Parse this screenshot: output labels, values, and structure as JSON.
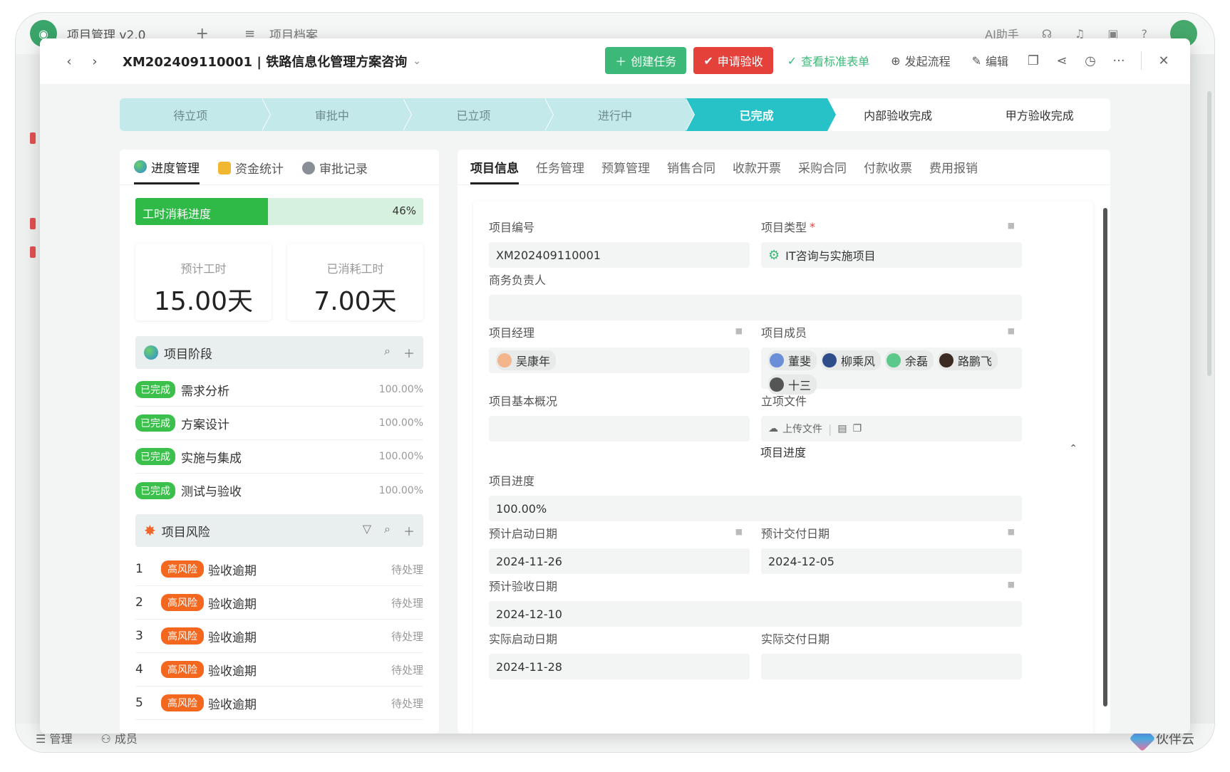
{
  "background": {
    "app_title": "项目管理 v2.0",
    "doc_title": "项目档案",
    "ai_label": "AI助手",
    "bottom_manage": "管理",
    "bottom_members": "成员",
    "brand_name": "伙伴云"
  },
  "header": {
    "project_code": "XM202409110001",
    "project_name": "铁路信息化管理方案咨询",
    "title": "XM202409110001 | 铁路信息化管理方案咨询",
    "create_task": "创建任务",
    "apply_acceptance": "申请验收",
    "view_standard_form": "查看标准表单",
    "start_flow": "发起流程",
    "edit": "编辑"
  },
  "steps": [
    {
      "label": "待立项",
      "state": "done"
    },
    {
      "label": "审批中",
      "state": "done"
    },
    {
      "label": "已立项",
      "state": "done"
    },
    {
      "label": "进行中",
      "state": "done"
    },
    {
      "label": "已完成",
      "state": "current"
    },
    {
      "label": "内部验收完成",
      "state": "todo"
    },
    {
      "label": "甲方验收完成",
      "state": "todo"
    }
  ],
  "left": {
    "tabs": [
      "进度管理",
      "资金统计",
      "审批记录"
    ],
    "hours_label": "工时消耗进度",
    "hours_pct": "46%",
    "hours_value": 0.46,
    "planned_label": "预计工时",
    "planned_value": "15.00天",
    "used_label": "已消耗工时",
    "used_value": "7.00天",
    "stage_title": "项目阶段",
    "stages": [
      {
        "badge": "已完成",
        "name": "需求分析",
        "pct": "100.00%"
      },
      {
        "badge": "已完成",
        "name": "方案设计",
        "pct": "100.00%"
      },
      {
        "badge": "已完成",
        "name": "实施与集成",
        "pct": "100.00%"
      },
      {
        "badge": "已完成",
        "name": "测试与验收",
        "pct": "100.00%"
      }
    ],
    "risk_title": "项目风险",
    "risks": [
      {
        "num": "1",
        "badge": "高风险",
        "name": "验收逾期",
        "status": "待处理"
      },
      {
        "num": "2",
        "badge": "高风险",
        "name": "验收逾期",
        "status": "待处理"
      },
      {
        "num": "3",
        "badge": "高风险",
        "name": "验收逾期",
        "status": "待处理"
      },
      {
        "num": "4",
        "badge": "高风险",
        "name": "验收逾期",
        "status": "待处理"
      },
      {
        "num": "5",
        "badge": "高风险",
        "name": "验收逾期",
        "status": "待处理"
      }
    ]
  },
  "right": {
    "tabs": [
      "项目信息",
      "任务管理",
      "预算管理",
      "销售合同",
      "收款开票",
      "采购合同",
      "付款收票",
      "费用报销"
    ],
    "fields": {
      "code_label": "项目编号",
      "code_value": "XM202409110001",
      "type_label": "项目类型",
      "type_required": "*",
      "type_value": "IT咨询与实施项目",
      "biz_owner_label": "商务负责人",
      "biz_owner_value": "",
      "manager_label": "项目经理",
      "manager_value": "吴康年",
      "members_label": "项目成员",
      "members": [
        "董斐",
        "柳乘风",
        "余磊",
        "路鹏飞",
        "十三"
      ],
      "overview_label": "项目基本概况",
      "overview_value": "",
      "file_label": "立项文件",
      "upload_label": "上传文件",
      "progress_section": "项目进度",
      "progress_label": "项目进度",
      "progress_value": "100.00%",
      "start_plan_label": "预计启动日期",
      "start_plan_value": "2024-11-26",
      "delivery_plan_label": "预计交付日期",
      "delivery_plan_value": "2024-12-05",
      "accept_plan_label": "预计验收日期",
      "accept_plan_value": "2024-12-10",
      "start_actual_label": "实际启动日期",
      "start_actual_value": "2024-11-28",
      "delivery_actual_label": "实际交付日期",
      "delivery_actual_value": ""
    }
  },
  "colors": {
    "green": "#3cb878",
    "red": "#e5413b",
    "teal": "#26c2c8",
    "risk_orange": "#f4671f",
    "done_green": "#3cc04c"
  }
}
